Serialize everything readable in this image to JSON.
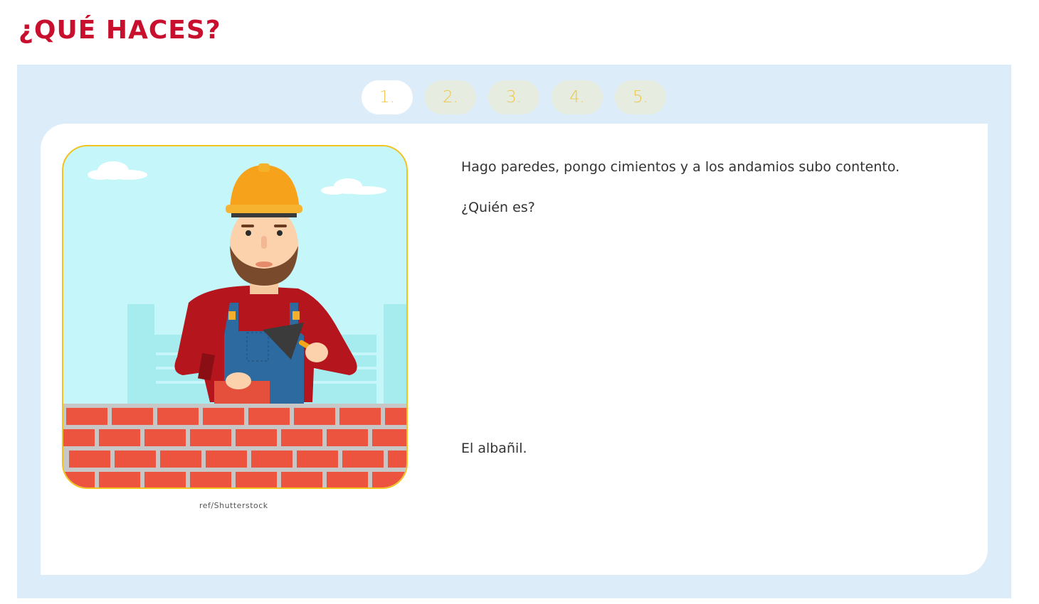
{
  "title": "¿QUÉ HACES?",
  "tabs": [
    {
      "label": "1.",
      "active": true
    },
    {
      "label": "2.",
      "active": false
    },
    {
      "label": "3.",
      "active": false
    },
    {
      "label": "4.",
      "active": false
    },
    {
      "label": "5.",
      "active": false
    }
  ],
  "card": {
    "image": {
      "subject": "bricklayer-illustration",
      "credit": "ref/Shutterstock"
    },
    "riddle": "Hago paredes, pongo cimientos y a los andamios subo contento.",
    "question": "¿Quién es?",
    "answer": "El albañil."
  },
  "colors": {
    "title": "#c8102e",
    "panel_bg": "#ddecf9",
    "tab_inactive_bg": "#e6ecdf",
    "tab_text": "#edc74a",
    "image_border": "#f2c21d"
  }
}
